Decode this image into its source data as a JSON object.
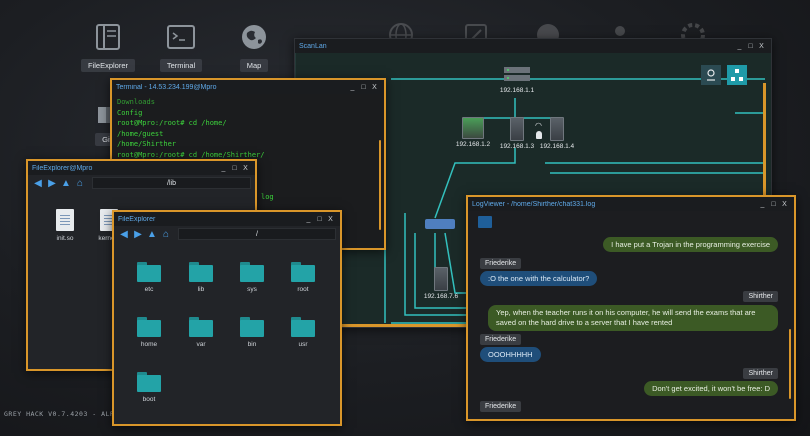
{
  "desktop": {
    "icons": [
      {
        "label": "FileExplorer",
        "icon": "file-explorer-icon"
      },
      {
        "label": "Terminal",
        "icon": "terminal-icon"
      },
      {
        "label": "Map",
        "icon": "map-icon"
      },
      {
        "label": "Gift",
        "icon": "gift-icon"
      }
    ],
    "version": "GREY HACK V0.7.4203 - ALPHA"
  },
  "terminal": {
    "title": "Terminal - 14.53.234.199@Mpro",
    "lines": [
      "Downloads",
      "Config",
      "root@Mpro:/root# cd /home/",
      "/home/guest",
      "/home/Shirther",
      "root@Mpro:/root# cd /home/Shirther/",
      "root@Mpro:/home/Shirther# ls",
      "",
      "",
      "log"
    ],
    "controls": [
      "_",
      "□",
      "X"
    ]
  },
  "file_explorer_mpro": {
    "title": "FileExplorer@Mpro",
    "path": "/lib",
    "files": [
      "init.so",
      "kernel_"
    ]
  },
  "file_explorer": {
    "title": "FileExplorer",
    "path": "/",
    "folders": [
      "etc",
      "lib",
      "sys",
      "root",
      "home",
      "var",
      "bin",
      "usr",
      "boot"
    ]
  },
  "scanlan": {
    "title": "ScanLan",
    "router": "192.168.1.1",
    "nodes": [
      "192.168.1.2",
      "192.168.1.3",
      "192.168.1.4",
      "192.168.7.6"
    ]
  },
  "logviewer": {
    "title": "LogViewer - /home/Shirther/chat331.log",
    "messages": [
      {
        "kind": "out",
        "text": "I have put a Trojan in the programming exercise"
      },
      {
        "kind": "name",
        "text": "Friederike"
      },
      {
        "kind": "in",
        "text": ":O the one with the calculator?"
      },
      {
        "kind": "name",
        "text": "Shirther"
      },
      {
        "kind": "out",
        "text": "Yep, when the teacher runs it on his computer, he will send the exams that are saved on the hard drive to a server that I have rented"
      },
      {
        "kind": "name",
        "text": "Friederike"
      },
      {
        "kind": "in",
        "text": "OOOHHHHH"
      },
      {
        "kind": "name",
        "text": "Shirther"
      },
      {
        "kind": "out",
        "text": "Don't get excited, it won't be free: D"
      },
      {
        "kind": "name",
        "text": "Friederike"
      }
    ]
  },
  "colors": {
    "accent": "#d9962a",
    "terminal_text": "#3cd23c",
    "title_text": "#5fa9e8",
    "folder": "#23a3a7"
  }
}
